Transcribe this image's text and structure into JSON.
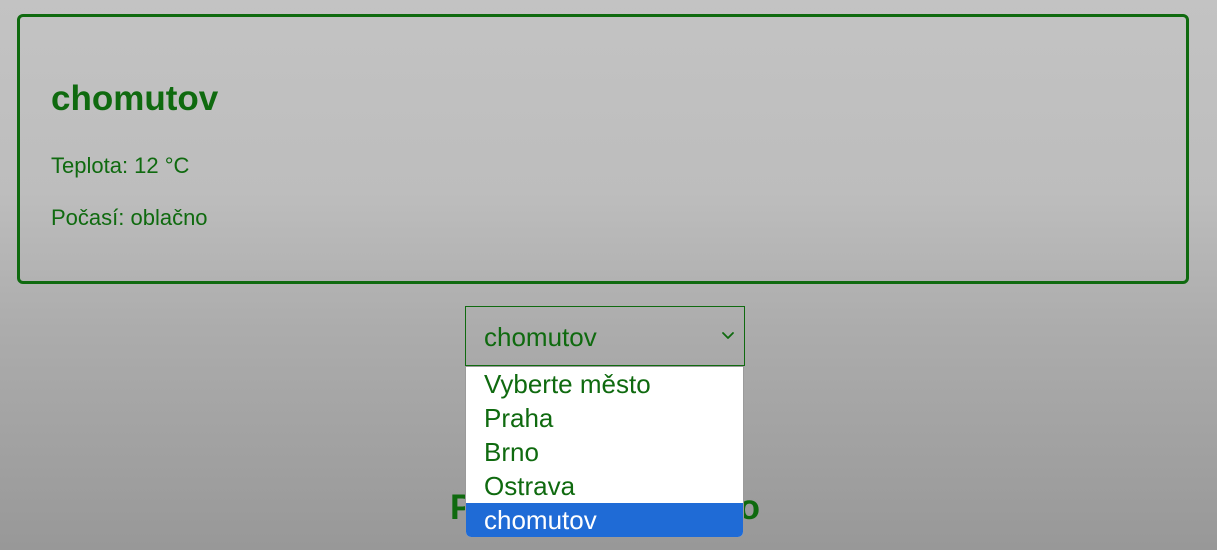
{
  "card": {
    "city": "chomutov",
    "temperature_label": "Teplota: 12 °C",
    "condition_label": "Počasí: oblačno"
  },
  "heading_behind": {
    "left_letter": "P",
    "right_letter": "o"
  },
  "select": {
    "value": "chomutov",
    "options": [
      "Vyberte město",
      "Praha",
      "Brno",
      "Ostrava",
      "chomutov"
    ],
    "selected_index": 4
  },
  "colors": {
    "accent": "#0f6a0f",
    "highlight": "#1f6bd6",
    "dropdown_bg": "#ffffff"
  },
  "icons": {
    "select_chevron": "chevron-down-icon"
  }
}
